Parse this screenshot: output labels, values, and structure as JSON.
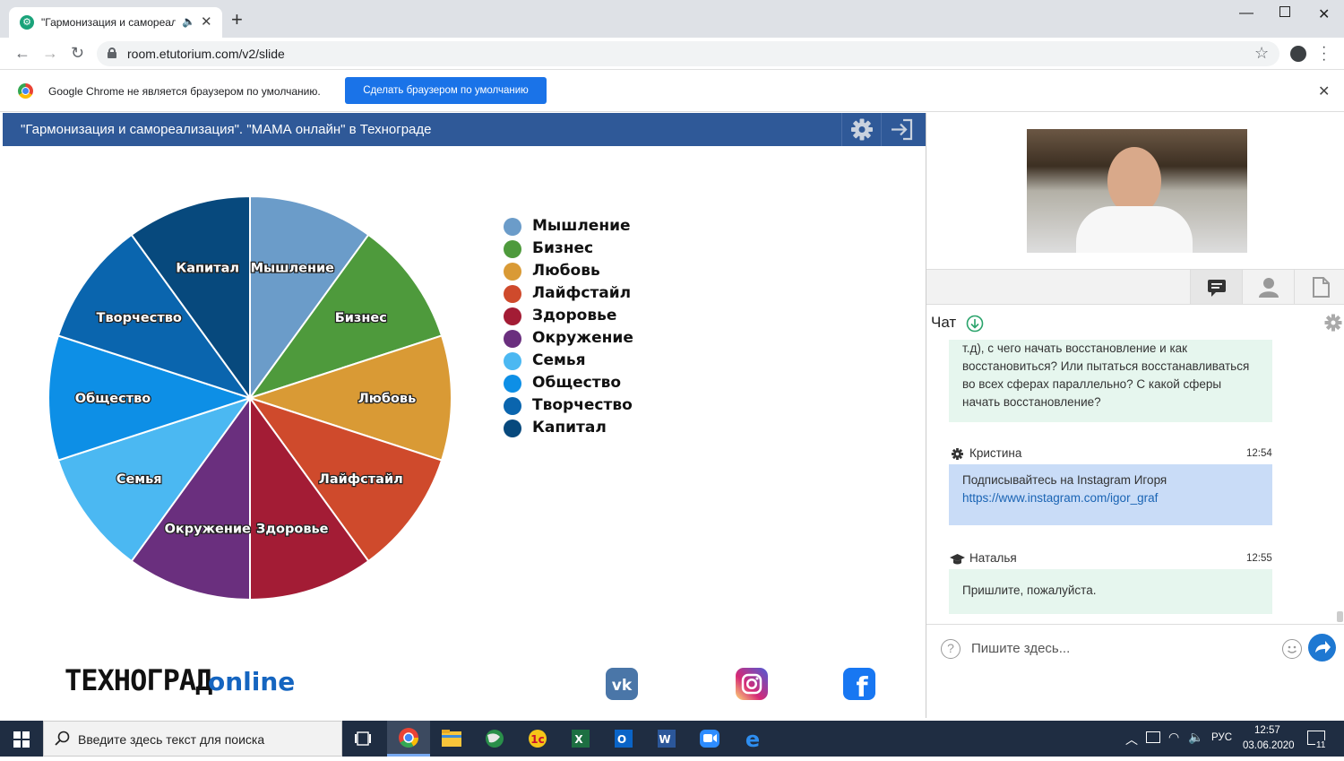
{
  "browser": {
    "tab_title": "\"Гармонизация и самореал",
    "url": "room.etutorium.com/v2/slide",
    "infobar_text": "Google Chrome не является браузером по умолчанию.",
    "infobar_button": "Сделать браузером по умолчанию",
    "icons": [
      "back-arrow-icon",
      "forward-arrow-icon",
      "reload-icon",
      "lock-icon",
      "star-icon",
      "profile-icon",
      "kebab-menu-icon"
    ]
  },
  "slide": {
    "title": "\"Гармонизация и самореализация\". \"МАМА онлайн\" в Технограде",
    "logo_text": "ТЕХНОГРАД",
    "logo_suffix": "online"
  },
  "chart_data": {
    "type": "pie",
    "slices": [
      {
        "label": "Мышление",
        "value": 1,
        "color": "#6b9cc9"
      },
      {
        "label": "Бизнес",
        "value": 1,
        "color": "#4e9a3c"
      },
      {
        "label": "Любовь",
        "value": 1,
        "color": "#d99a35"
      },
      {
        "label": "Лайфстайл",
        "value": 1,
        "color": "#cf4a2c"
      },
      {
        "label": "Здоровье",
        "value": 1,
        "color": "#a31c35"
      },
      {
        "label": "Окружение",
        "value": 1,
        "color": "#6a2f7e"
      },
      {
        "label": "Семья",
        "value": 1,
        "color": "#4bb8f2"
      },
      {
        "label": "Общество",
        "value": 1,
        "color": "#0d8fe6"
      },
      {
        "label": "Творчество",
        "value": 1,
        "color": "#0a65ae"
      },
      {
        "label": "Капитал",
        "value": 1,
        "color": "#07497d"
      }
    ],
    "legend": [
      "Мышление",
      "Бизнес",
      "Любовь",
      "Лайфстайл",
      "Здоровье",
      "Окружение",
      "Семья",
      "Общество",
      "Творчество",
      "Капитал"
    ],
    "legend_placement": "right"
  },
  "chat": {
    "title": "Чат",
    "messages": [
      {
        "author": "",
        "time": "",
        "text": "т.д), с чего начать восстановление и как восстановиться? Или пытаться восстанавливаться во всех сферах параллельно? С какой сферы начать восстановление?",
        "color": "#e6f6ee"
      },
      {
        "author": "Кристина",
        "time": "12:54",
        "text": "Подписывайтесь на Instagram Игоря",
        "link": "https://www.instagram.com/igor_graf",
        "color": "#c9dcf7"
      },
      {
        "author": "Наталья",
        "time": "12:55",
        "text": "Пришлите, пожалуйста.",
        "color": "#e6f6ee"
      }
    ],
    "input_placeholder": "Пишите здесь..."
  },
  "taskbar": {
    "search_placeholder": "Введите здесь текст для поиска",
    "lang": "РУС",
    "time": "12:57",
    "date": "03.06.2020",
    "notifications": "11"
  }
}
